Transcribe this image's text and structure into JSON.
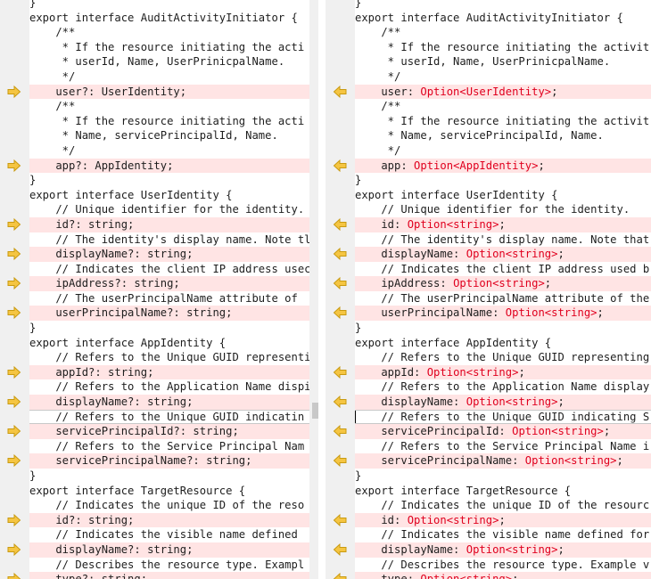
{
  "colors": {
    "changed_bg": "#ffe4e4",
    "gutter_bg": "#f0f0f0",
    "arrow_fill": "#f5c542",
    "type_highlight": "#e0001e"
  },
  "left_pane": {
    "marker_icon": "arrow-right-icon",
    "lines": [
      {
        "text": "}",
        "changed": false,
        "marker": false
      },
      {
        "text": "export interface AuditActivityInitiator {",
        "changed": false,
        "marker": false
      },
      {
        "text": "    /**",
        "changed": false,
        "marker": false
      },
      {
        "text": "     * If the resource initiating the acti",
        "changed": false,
        "marker": false
      },
      {
        "text": "     * userId, Name, UserPrinicpalName.",
        "changed": false,
        "marker": false
      },
      {
        "text": "     */",
        "changed": false,
        "marker": false
      },
      {
        "text": "    user?: UserIdentity;",
        "changed": true,
        "marker": true
      },
      {
        "text": "    /**",
        "changed": false,
        "marker": false
      },
      {
        "text": "     * If the resource initiating the acti",
        "changed": false,
        "marker": false
      },
      {
        "text": "     * Name, servicePrincipalId, Name.",
        "changed": false,
        "marker": false
      },
      {
        "text": "     */",
        "changed": false,
        "marker": false
      },
      {
        "text": "    app?: AppIdentity;",
        "changed": true,
        "marker": true
      },
      {
        "text": "}",
        "changed": false,
        "marker": false
      },
      {
        "text": "export interface UserIdentity {",
        "changed": false,
        "marker": false
      },
      {
        "text": "    // Unique identifier for the identity.",
        "changed": false,
        "marker": false
      },
      {
        "text": "    id?: string;",
        "changed": true,
        "marker": true
      },
      {
        "text": "    // The identity's display name. Note tl",
        "changed": false,
        "marker": false
      },
      {
        "text": "    displayName?: string;",
        "changed": true,
        "marker": true
      },
      {
        "text": "    // Indicates the client IP address usec",
        "changed": false,
        "marker": false
      },
      {
        "text": "    ipAddress?: string;",
        "changed": true,
        "marker": true
      },
      {
        "text": "    // The userPrincipalName attribute of ",
        "changed": false,
        "marker": false
      },
      {
        "text": "    userPrincipalName?: string;",
        "changed": true,
        "marker": true
      },
      {
        "text": "}",
        "changed": false,
        "marker": false
      },
      {
        "text": "export interface AppIdentity {",
        "changed": false,
        "marker": false
      },
      {
        "text": "    // Refers to the Unique GUID representi",
        "changed": false,
        "marker": false
      },
      {
        "text": "    appId?: string;",
        "changed": true,
        "marker": true
      },
      {
        "text": "    // Refers to the Application Name dispi",
        "changed": false,
        "marker": false
      },
      {
        "text": "    displayName?: string;",
        "changed": true,
        "marker": true
      },
      {
        "text": "    // Refers to the Unique GUID indicatin",
        "changed": false,
        "marker": false,
        "focus": true
      },
      {
        "text": "    servicePrincipalId?: string;",
        "changed": true,
        "marker": true
      },
      {
        "text": "    // Refers to the Service Principal Nam",
        "changed": false,
        "marker": false
      },
      {
        "text": "    servicePrincipalName?: string;",
        "changed": true,
        "marker": true
      },
      {
        "text": "}",
        "changed": false,
        "marker": false
      },
      {
        "text": "export interface TargetResource {",
        "changed": false,
        "marker": false
      },
      {
        "text": "    // Indicates the unique ID of the reso",
        "changed": false,
        "marker": false
      },
      {
        "text": "    id?: string;",
        "changed": true,
        "marker": true
      },
      {
        "text": "    // Indicates the visible name defined ",
        "changed": false,
        "marker": false
      },
      {
        "text": "    displayName?: string;",
        "changed": true,
        "marker": true
      },
      {
        "text": "    // Describes the resource type. Exampl",
        "changed": false,
        "marker": false
      },
      {
        "text": "    type?: string;",
        "changed": true,
        "marker": true
      }
    ]
  },
  "right_pane": {
    "marker_icon": "arrow-left-icon",
    "lines": [
      {
        "text": "}",
        "changed": false,
        "marker": false
      },
      {
        "text": "export interface AuditActivityInitiator {",
        "changed": false,
        "marker": false
      },
      {
        "text": "    /**",
        "changed": false,
        "marker": false
      },
      {
        "text": "     * If the resource initiating the activit",
        "changed": false,
        "marker": false
      },
      {
        "text": "     * userId, Name, UserPrinicpalName.",
        "changed": false,
        "marker": false
      },
      {
        "text": "     */",
        "changed": false,
        "marker": false
      },
      {
        "text": "    user: Option<UserIdentity>;",
        "changed": true,
        "marker": true
      },
      {
        "text": "    /**",
        "changed": false,
        "marker": false
      },
      {
        "text": "     * If the resource initiating the activit",
        "changed": false,
        "marker": false
      },
      {
        "text": "     * Name, servicePrincipalId, Name.",
        "changed": false,
        "marker": false
      },
      {
        "text": "     */",
        "changed": false,
        "marker": false
      },
      {
        "text": "    app: Option<AppIdentity>;",
        "changed": true,
        "marker": true
      },
      {
        "text": "}",
        "changed": false,
        "marker": false
      },
      {
        "text": "export interface UserIdentity {",
        "changed": false,
        "marker": false
      },
      {
        "text": "    // Unique identifier for the identity.",
        "changed": false,
        "marker": false
      },
      {
        "text": "    id: Option<string>;",
        "changed": true,
        "marker": true
      },
      {
        "text": "    // The identity's display name. Note that",
        "changed": false,
        "marker": false
      },
      {
        "text": "    displayName: Option<string>;",
        "changed": true,
        "marker": true
      },
      {
        "text": "    // Indicates the client IP address used b",
        "changed": false,
        "marker": false
      },
      {
        "text": "    ipAddress: Option<string>;",
        "changed": true,
        "marker": true
      },
      {
        "text": "    // The userPrincipalName attribute of the",
        "changed": false,
        "marker": false
      },
      {
        "text": "    userPrincipalName: Option<string>;",
        "changed": true,
        "marker": true
      },
      {
        "text": "}",
        "changed": false,
        "marker": false
      },
      {
        "text": "export interface AppIdentity {",
        "changed": false,
        "marker": false
      },
      {
        "text": "    // Refers to the Unique GUID representing",
        "changed": false,
        "marker": false
      },
      {
        "text": "    appId: Option<string>;",
        "changed": true,
        "marker": true
      },
      {
        "text": "    // Refers to the Application Name display",
        "changed": false,
        "marker": false
      },
      {
        "text": "    displayName: Option<string>;",
        "changed": true,
        "marker": true
      },
      {
        "text": "    // Refers to the Unique GUID indicating S",
        "changed": false,
        "marker": false,
        "focus": true,
        "caret": true
      },
      {
        "text": "    servicePrincipalId: Option<string>;",
        "changed": true,
        "marker": true
      },
      {
        "text": "    // Refers to the Service Principal Name i",
        "changed": false,
        "marker": false
      },
      {
        "text": "    servicePrincipalName: Option<string>;",
        "changed": true,
        "marker": true
      },
      {
        "text": "}",
        "changed": false,
        "marker": false
      },
      {
        "text": "export interface TargetResource {",
        "changed": false,
        "marker": false
      },
      {
        "text": "    // Indicates the unique ID of the resourc",
        "changed": false,
        "marker": false
      },
      {
        "text": "    id: Option<string>;",
        "changed": true,
        "marker": true
      },
      {
        "text": "    // Indicates the visible name defined for",
        "changed": false,
        "marker": false
      },
      {
        "text": "    displayName: Option<string>;",
        "changed": true,
        "marker": true
      },
      {
        "text": "    // Describes the resource type. Example v",
        "changed": false,
        "marker": false
      },
      {
        "text": "    type: Option<string>;",
        "changed": true,
        "marker": true
      }
    ]
  }
}
